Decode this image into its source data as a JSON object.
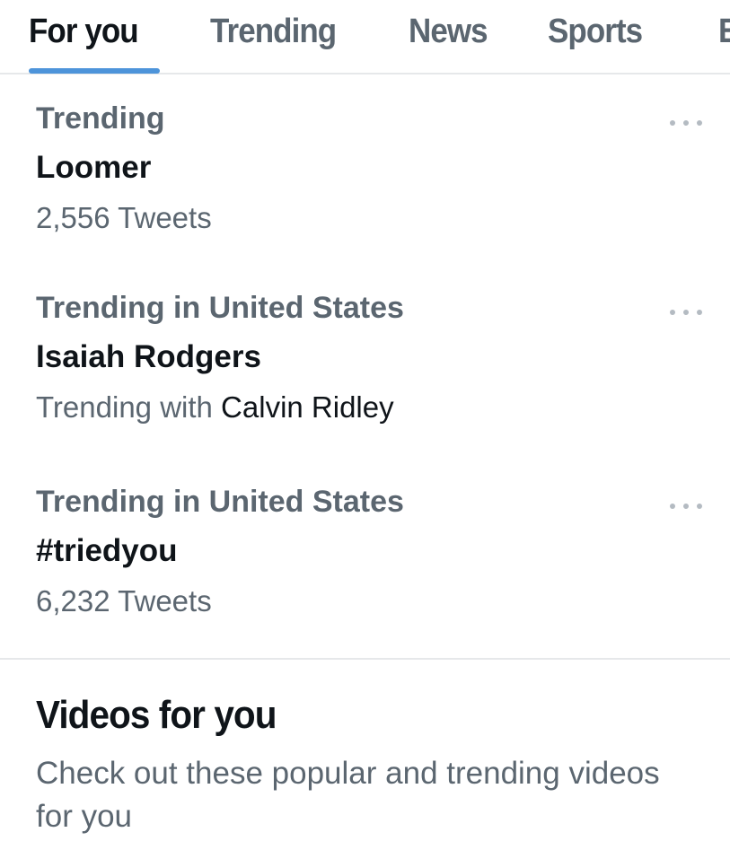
{
  "tabs": [
    {
      "label": "For you",
      "active": true
    },
    {
      "label": "Trending",
      "active": false
    },
    {
      "label": "News",
      "active": false
    },
    {
      "label": "Sports",
      "active": false
    },
    {
      "label": "E",
      "active": false
    }
  ],
  "colors": {
    "accent": "#4d94da",
    "primary_text": "#0f1419",
    "secondary_text": "#5b6670",
    "divider": "#e6e8ea"
  },
  "trends": [
    {
      "context": "Trending",
      "name": "Loomer",
      "meta": "2,556 Tweets",
      "more_icon": "more-horizontal-icon"
    },
    {
      "context": "Trending in United States",
      "name": "Isaiah Rodgers",
      "meta_prefix": "Trending with",
      "meta_with": "Calvin Ridley",
      "more_icon": "more-horizontal-icon"
    },
    {
      "context": "Trending in United States",
      "name": "#triedyou",
      "meta": "6,232 Tweets",
      "more_icon": "more-horizontal-icon"
    }
  ],
  "videos_section": {
    "title": "Videos for you",
    "subtitle": "Check out these popular and trending videos for you"
  }
}
